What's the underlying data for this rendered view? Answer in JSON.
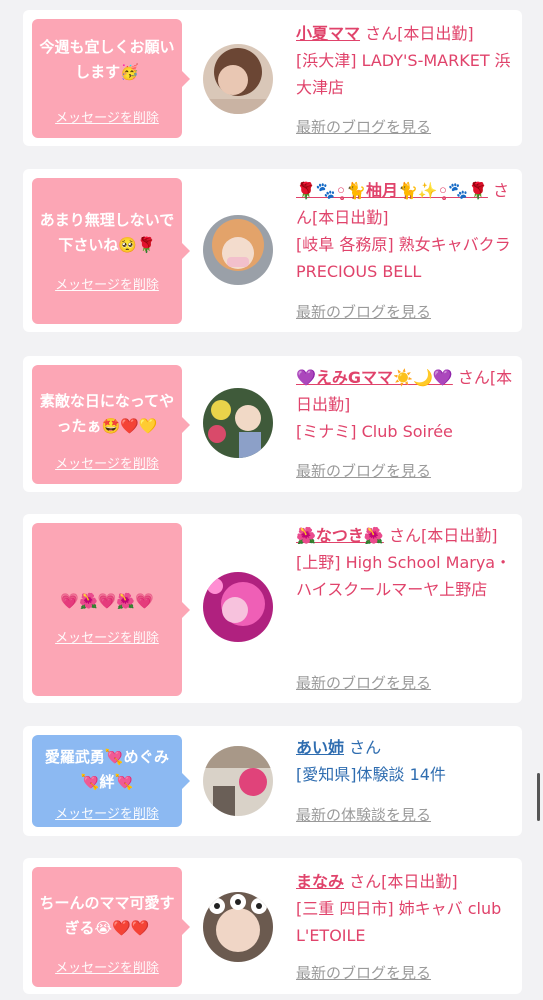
{
  "cards": [
    {
      "message": "今週も宜しくお願いします🥳",
      "delete_label": "メッセージを削除",
      "name": "小夏ママ",
      "san": "さん[本日出勤]",
      "shop": "[浜大津] LADY'S-MARKET 浜大津店",
      "blog_link": "最新のブログを見る"
    },
    {
      "message": "あまり無理しないで下さいね🥺🌹",
      "delete_label": "メッセージを削除",
      "name": "🌹🐾◦̥̥̥̥🐈柚月🐈✨◦̥̥̥̥🐾🌹",
      "san": "さん[本日出勤]",
      "shop": "[岐阜 各務原] 熟女キャバクラ PRECIOUS BELL",
      "blog_link": "最新のブログを見る"
    },
    {
      "message": "素敵な日になってやったぁ🤩❤️💛",
      "delete_label": "メッセージを削除",
      "name": "💜えみGママ☀️🌙💜",
      "san": "さん[本日出勤]",
      "shop": "[ミナミ] Club Soirée",
      "blog_link": "最新のブログを見る"
    },
    {
      "message": "💗🌺💗🌺💗",
      "delete_label": "メッセージを削除",
      "name": "🌺なつき🌺",
      "san": "さん[本日出勤]",
      "shop": "[上野] High School Marya・ハイスクールマーヤ上野店",
      "blog_link": "最新のブログを見る"
    },
    {
      "message": "愛羅武勇💘めぐみ💘絆💘",
      "delete_label": "メッセージを削除",
      "name": "あい姉",
      "san": "さん",
      "shop": "[愛知県]体験談 14件",
      "blog_link": "最新の体験談を見る"
    },
    {
      "message": "ちーんのママ可愛すぎる😭❤️❤️",
      "delete_label": "メッセージを削除",
      "name": "まなみ",
      "san": "さん[本日出勤]",
      "shop": "[三重 四日市] 姉キャバ club L'ETOILE",
      "blog_link": "最新のブログを見る"
    }
  ],
  "colors": {
    "bubble_pink": "#fca6b5",
    "bubble_blue": "#8cb9f2",
    "text_pink": "#e0436b",
    "text_blue": "#2f6db0",
    "link_gray": "#9a9a9a"
  }
}
